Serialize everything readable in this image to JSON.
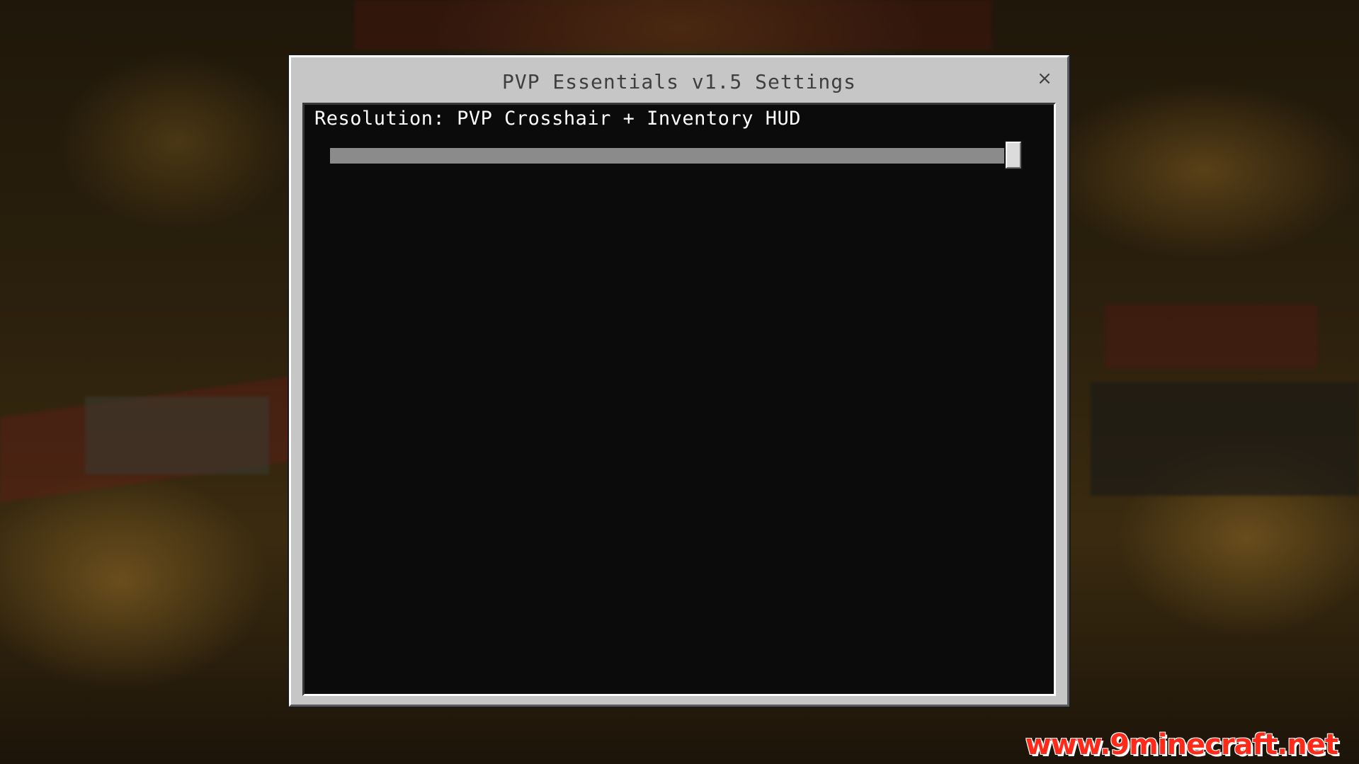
{
  "window": {
    "title": "PVP Essentials v1.5 Settings",
    "close_symbol": "×"
  },
  "setting": {
    "label": "Resolution: PVP Crosshair + Inventory HUD",
    "slider_value_fraction": 1.0
  },
  "watermark": {
    "text": "www.9minecraft.net"
  },
  "colors": {
    "panel": "#c6c6c6",
    "content_bg": "#0b0b0b",
    "slider_fill": "#8b8b8b",
    "watermark": "#ff2a1a"
  }
}
